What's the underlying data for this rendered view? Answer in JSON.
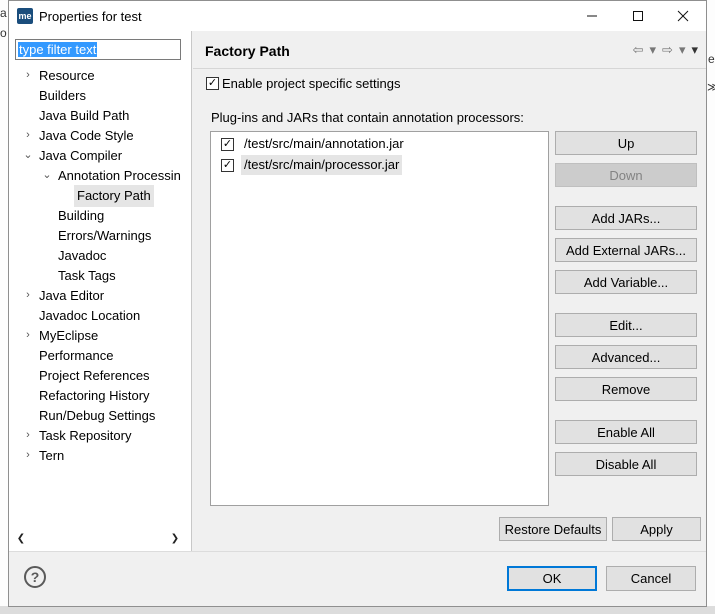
{
  "window": {
    "app_icon": "me",
    "title": "Properties for test",
    "minimize_icon": "minimize-icon",
    "maximize_icon": "maximize-icon",
    "close_icon": "close-icon"
  },
  "background": {
    "glyph_1": "a",
    "glyph_2": "o",
    "glyph_3": "e",
    "glyph_4": "≫"
  },
  "filter": {
    "value": "type filter text"
  },
  "tree": {
    "items": [
      {
        "label": "Resource",
        "expandable": true,
        "expanded": false,
        "level": 0
      },
      {
        "label": "Builders",
        "expandable": false,
        "level": 0
      },
      {
        "label": "Java Build Path",
        "expandable": false,
        "level": 0
      },
      {
        "label": "Java Code Style",
        "expandable": true,
        "expanded": false,
        "level": 0
      },
      {
        "label": "Java Compiler",
        "expandable": true,
        "expanded": true,
        "level": 0
      },
      {
        "label": "Annotation Processin",
        "expandable": true,
        "expanded": true,
        "level": 1
      },
      {
        "label": "Factory Path",
        "expandable": false,
        "level": 2,
        "selected": true
      },
      {
        "label": "Building",
        "expandable": false,
        "level": 1
      },
      {
        "label": "Errors/Warnings",
        "expandable": false,
        "level": 1
      },
      {
        "label": "Javadoc",
        "expandable": false,
        "level": 1
      },
      {
        "label": "Task Tags",
        "expandable": false,
        "level": 1
      },
      {
        "label": "Java Editor",
        "expandable": true,
        "expanded": false,
        "level": 0
      },
      {
        "label": "Javadoc Location",
        "expandable": false,
        "level": 0
      },
      {
        "label": "MyEclipse",
        "expandable": true,
        "expanded": false,
        "level": 0
      },
      {
        "label": "Performance",
        "expandable": false,
        "level": 0
      },
      {
        "label": "Project References",
        "expandable": false,
        "level": 0
      },
      {
        "label": "Refactoring History",
        "expandable": false,
        "level": 0
      },
      {
        "label": "Run/Debug Settings",
        "expandable": false,
        "level": 0
      },
      {
        "label": "Task Repository",
        "expandable": true,
        "expanded": false,
        "level": 0
      },
      {
        "label": "Tern",
        "expandable": true,
        "expanded": false,
        "level": 0
      }
    ]
  },
  "page": {
    "title": "Factory Path",
    "enable_label": "Enable project specific settings",
    "enable_checked": true,
    "list_description": "Plug-ins and JARs that contain annotation processors:",
    "jars": [
      {
        "path": "/test/src/main/annotation.jar",
        "checked": true,
        "selected": false
      },
      {
        "path": "/test/src/main/processor.jar",
        "checked": true,
        "selected": true
      }
    ]
  },
  "buttons": {
    "up": "Up",
    "down": "Down",
    "add_jars": "Add JARs...",
    "add_external_jars": "Add External JARs...",
    "add_variable": "Add Variable...",
    "edit": "Edit...",
    "advanced": "Advanced...",
    "remove": "Remove",
    "enable_all": "Enable All",
    "disable_all": "Disable All",
    "restore_defaults": "Restore Defaults",
    "apply": "Apply",
    "ok": "OK",
    "cancel": "Cancel"
  },
  "icons": {
    "check_glyph": "✓",
    "help_glyph": "?",
    "collapsed_glyph": "›",
    "expanded_glyph": "⌄",
    "back_glyph": "⇦",
    "forward_glyph": "⇨",
    "menu_glyph": "▾",
    "scroll_left_glyph": "❮",
    "scroll_right_glyph": "❯"
  },
  "colors": {
    "selection": "#e5e5e5",
    "filter_highlight": "#3399ff",
    "default_button_border": "#0078d7"
  }
}
